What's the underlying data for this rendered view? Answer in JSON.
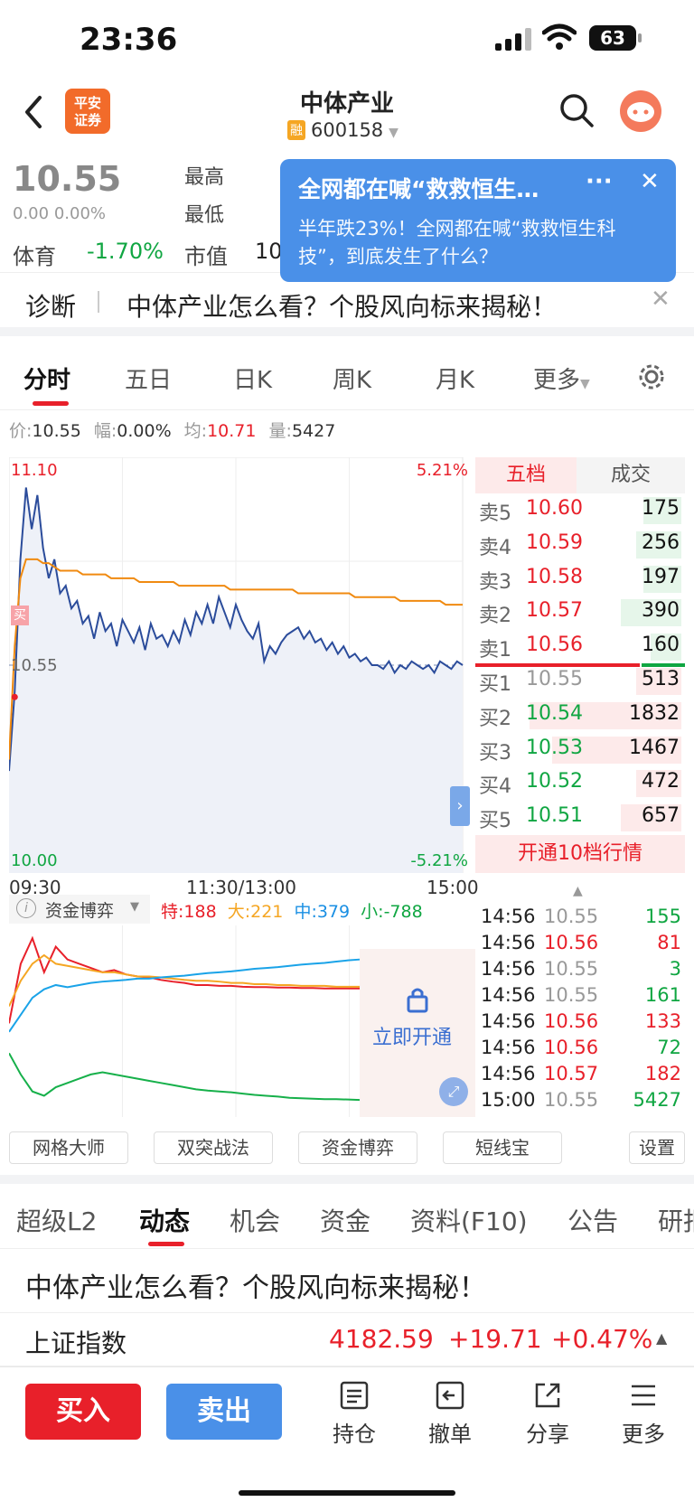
{
  "status": {
    "time": "23:36",
    "battery": "63"
  },
  "nav": {
    "title": "中体产业",
    "rong": "融",
    "code": "600158"
  },
  "logo": {
    "line1": "平安",
    "line2": "证券"
  },
  "quote": {
    "price": "10.55",
    "change": "0.00",
    "pct": "0.00%",
    "high_label": "最高",
    "low_label": "最低",
    "cap_label": "市值",
    "cap_value": "10",
    "sector": "体育",
    "sector_pct": "-1.70%"
  },
  "popup": {
    "title": "全网都在喊“救救恒生…",
    "more": "···",
    "close": "✕",
    "body": "半年跌23%！全网都在喊“救救恒生科技”，到底发生了什么？"
  },
  "diag": {
    "label": "诊断",
    "text": "中体产业怎么看？个股风向标来揭秘！",
    "close": "✕"
  },
  "chart_tabs": [
    "分时",
    "五日",
    "日K",
    "周K",
    "月K",
    "更多"
  ],
  "info": {
    "price_label": "价:",
    "price": "10.55",
    "amp_label": "幅:",
    "amp": "0.00%",
    "avg_label": "均:",
    "avg": "10.71",
    "vol_label": "量:",
    "vol": "5427"
  },
  "chart_labels": {
    "top_price": "11.10",
    "top_pct": "5.21%",
    "mid_price": "10.55",
    "bottom_price": "10.00",
    "bottom_pct": "-5.21%",
    "buy_marker": "买",
    "t_start": "09:30",
    "t_mid": "11:30/13:00",
    "t_end": "15:00"
  },
  "chart_data": {
    "type": "line",
    "x_range": [
      "09:30",
      "15:00"
    ],
    "ylim": [
      10.0,
      11.1
    ],
    "prev_close": 10.55,
    "series": [
      {
        "name": "价",
        "color": "#2b4c9b",
        "values": [
          10.27,
          10.48,
          10.83,
          11.02,
          10.91,
          11.0,
          10.86,
          10.78,
          10.83,
          10.74,
          10.76,
          10.7,
          10.72,
          10.66,
          10.68,
          10.62,
          10.69,
          10.64,
          10.66,
          10.6,
          10.67,
          10.64,
          10.61,
          10.65,
          10.59,
          10.66,
          10.62,
          10.63,
          10.6,
          10.64,
          10.61,
          10.67,
          10.63,
          10.69,
          10.66,
          10.71,
          10.66,
          10.73,
          10.69,
          10.65,
          10.71,
          10.67,
          10.64,
          10.62,
          10.66,
          10.56,
          10.6,
          10.58,
          10.61,
          10.63,
          10.64,
          10.65,
          10.62,
          10.64,
          10.61,
          10.62,
          10.59,
          10.61,
          10.58,
          10.6,
          10.57,
          10.58,
          10.56,
          10.57,
          10.55,
          10.55,
          10.54,
          10.56,
          10.53,
          10.55,
          10.54,
          10.56,
          10.55,
          10.54,
          10.55,
          10.53,
          10.56,
          10.55,
          10.54,
          10.56,
          10.55
        ]
      },
      {
        "name": "均",
        "color": "#f08a10",
        "values": [
          10.3,
          10.6,
          10.78,
          10.83,
          10.83,
          10.83,
          10.82,
          10.82,
          10.81,
          10.8,
          10.8,
          10.8,
          10.8,
          10.79,
          10.79,
          10.79,
          10.79,
          10.79,
          10.78,
          10.78,
          10.78,
          10.78,
          10.78,
          10.77,
          10.77,
          10.77,
          10.77,
          10.77,
          10.77,
          10.77,
          10.76,
          10.76,
          10.76,
          10.76,
          10.76,
          10.76,
          10.76,
          10.76,
          10.76,
          10.75,
          10.75,
          10.75,
          10.75,
          10.75,
          10.75,
          10.75,
          10.75,
          10.75,
          10.75,
          10.75,
          10.75,
          10.74,
          10.74,
          10.74,
          10.74,
          10.74,
          10.74,
          10.74,
          10.74,
          10.74,
          10.74,
          10.73,
          10.73,
          10.73,
          10.73,
          10.73,
          10.73,
          10.73,
          10.73,
          10.72,
          10.72,
          10.72,
          10.72,
          10.72,
          10.72,
          10.72,
          10.72,
          10.71,
          10.71,
          10.71,
          10.71
        ]
      }
    ],
    "subchart": {
      "label": "资金博弈",
      "te_label": "特:",
      "te": "188",
      "da_label": "大:",
      "da": "221",
      "zhong_label": "中:",
      "zhong": "379",
      "xiao_label": "小:",
      "xiao": "-788",
      "lock_text": "立即开通",
      "series": [
        {
          "name": "特",
          "color": "#e8202a",
          "values": [
            -80,
            60,
            120,
            40,
            100,
            70,
            60,
            50,
            40,
            45,
            35,
            30,
            28,
            22,
            18,
            15,
            10,
            10,
            8,
            8,
            6,
            5,
            5,
            4,
            4,
            3,
            3,
            2,
            2,
            2,
            2
          ]
        },
        {
          "name": "大",
          "color": "#f5a623",
          "values": [
            -40,
            20,
            60,
            80,
            60,
            55,
            50,
            45,
            40,
            40,
            35,
            30,
            30,
            28,
            25,
            22,
            20,
            20,
            18,
            15,
            15,
            12,
            12,
            10,
            10,
            8,
            8,
            8,
            6,
            6,
            6
          ]
        },
        {
          "name": "中",
          "color": "#1aa3e8",
          "values": [
            -100,
            -60,
            -20,
            0,
            10,
            5,
            10,
            15,
            18,
            20,
            22,
            25,
            25,
            28,
            30,
            32,
            35,
            38,
            40,
            42,
            45,
            48,
            50,
            52,
            55,
            58,
            60,
            62,
            65,
            68,
            70
          ]
        },
        {
          "name": "小",
          "color": "#16b04a",
          "values": [
            -150,
            -200,
            -240,
            -250,
            -230,
            -220,
            -210,
            -200,
            -195,
            -200,
            -205,
            -210,
            -215,
            -220,
            -225,
            -230,
            -235,
            -238,
            -240,
            -242,
            -245,
            -248,
            -250,
            -252,
            -255,
            -256,
            -257,
            -258,
            -258,
            -259,
            -260
          ]
        }
      ]
    }
  },
  "book": {
    "tab1": "五档",
    "tab2": "成交",
    "asks": [
      {
        "label": "卖5",
        "price": "10.60",
        "vol": "175",
        "bar": 0.25
      },
      {
        "label": "卖4",
        "price": "10.59",
        "vol": "256",
        "bar": 0.3
      },
      {
        "label": "卖3",
        "price": "10.58",
        "vol": "197",
        "bar": 0.25
      },
      {
        "label": "卖2",
        "price": "10.57",
        "vol": "390",
        "bar": 0.4
      },
      {
        "label": "卖1",
        "price": "10.56",
        "vol": "160",
        "bar": 0.2
      }
    ],
    "bids": [
      {
        "label": "买1",
        "price": "10.55",
        "vol": "513",
        "bar": 0.3
      },
      {
        "label": "买2",
        "price": "10.54",
        "vol": "1832",
        "bar": 1.0
      },
      {
        "label": "买3",
        "price": "10.53",
        "vol": "1467",
        "bar": 0.85
      },
      {
        "label": "买4",
        "price": "10.52",
        "vol": "472",
        "bar": 0.3
      },
      {
        "label": "买5",
        "price": "10.51",
        "vol": "657",
        "bar": 0.4
      }
    ],
    "upsell": "开通10档行情"
  },
  "trades": [
    {
      "time": "14:56",
      "price": "10.55",
      "vol": "155",
      "pc": "gray",
      "vc": "green"
    },
    {
      "time": "14:56",
      "price": "10.56",
      "vol": "81",
      "pc": "red",
      "vc": "red"
    },
    {
      "time": "14:56",
      "price": "10.55",
      "vol": "3",
      "pc": "gray",
      "vc": "green"
    },
    {
      "time": "14:56",
      "price": "10.55",
      "vol": "161",
      "pc": "gray",
      "vc": "green"
    },
    {
      "time": "14:56",
      "price": "10.56",
      "vol": "133",
      "pc": "red",
      "vc": "red"
    },
    {
      "time": "14:56",
      "price": "10.56",
      "vol": "72",
      "pc": "red",
      "vc": "green"
    },
    {
      "time": "14:56",
      "price": "10.57",
      "vol": "182",
      "pc": "red",
      "vc": "red"
    },
    {
      "time": "15:00",
      "price": "10.55",
      "vol": "5427",
      "pc": "gray",
      "vc": "green"
    }
  ],
  "tools": [
    "网格大师",
    "双突战法",
    "资金博弈",
    "短线宝",
    "设置"
  ],
  "bottom_tabs": [
    "超级L2",
    "动态",
    "机会",
    "资金",
    "资料(F10)",
    "公告",
    "研报"
  ],
  "news": "中体产业怎么看？个股风向标来揭秘！",
  "index": {
    "name": "上证指数",
    "value": "4182.59",
    "change": "+19.71",
    "pct": "+0.47%"
  },
  "actions": {
    "buy": "买入",
    "sell": "卖出",
    "hold": "持仓",
    "cancel": "撤单",
    "share": "分享",
    "more": "更多"
  },
  "colors": {
    "up": "#e8202a",
    "down": "#10a642",
    "accent": "#4a90e8"
  }
}
